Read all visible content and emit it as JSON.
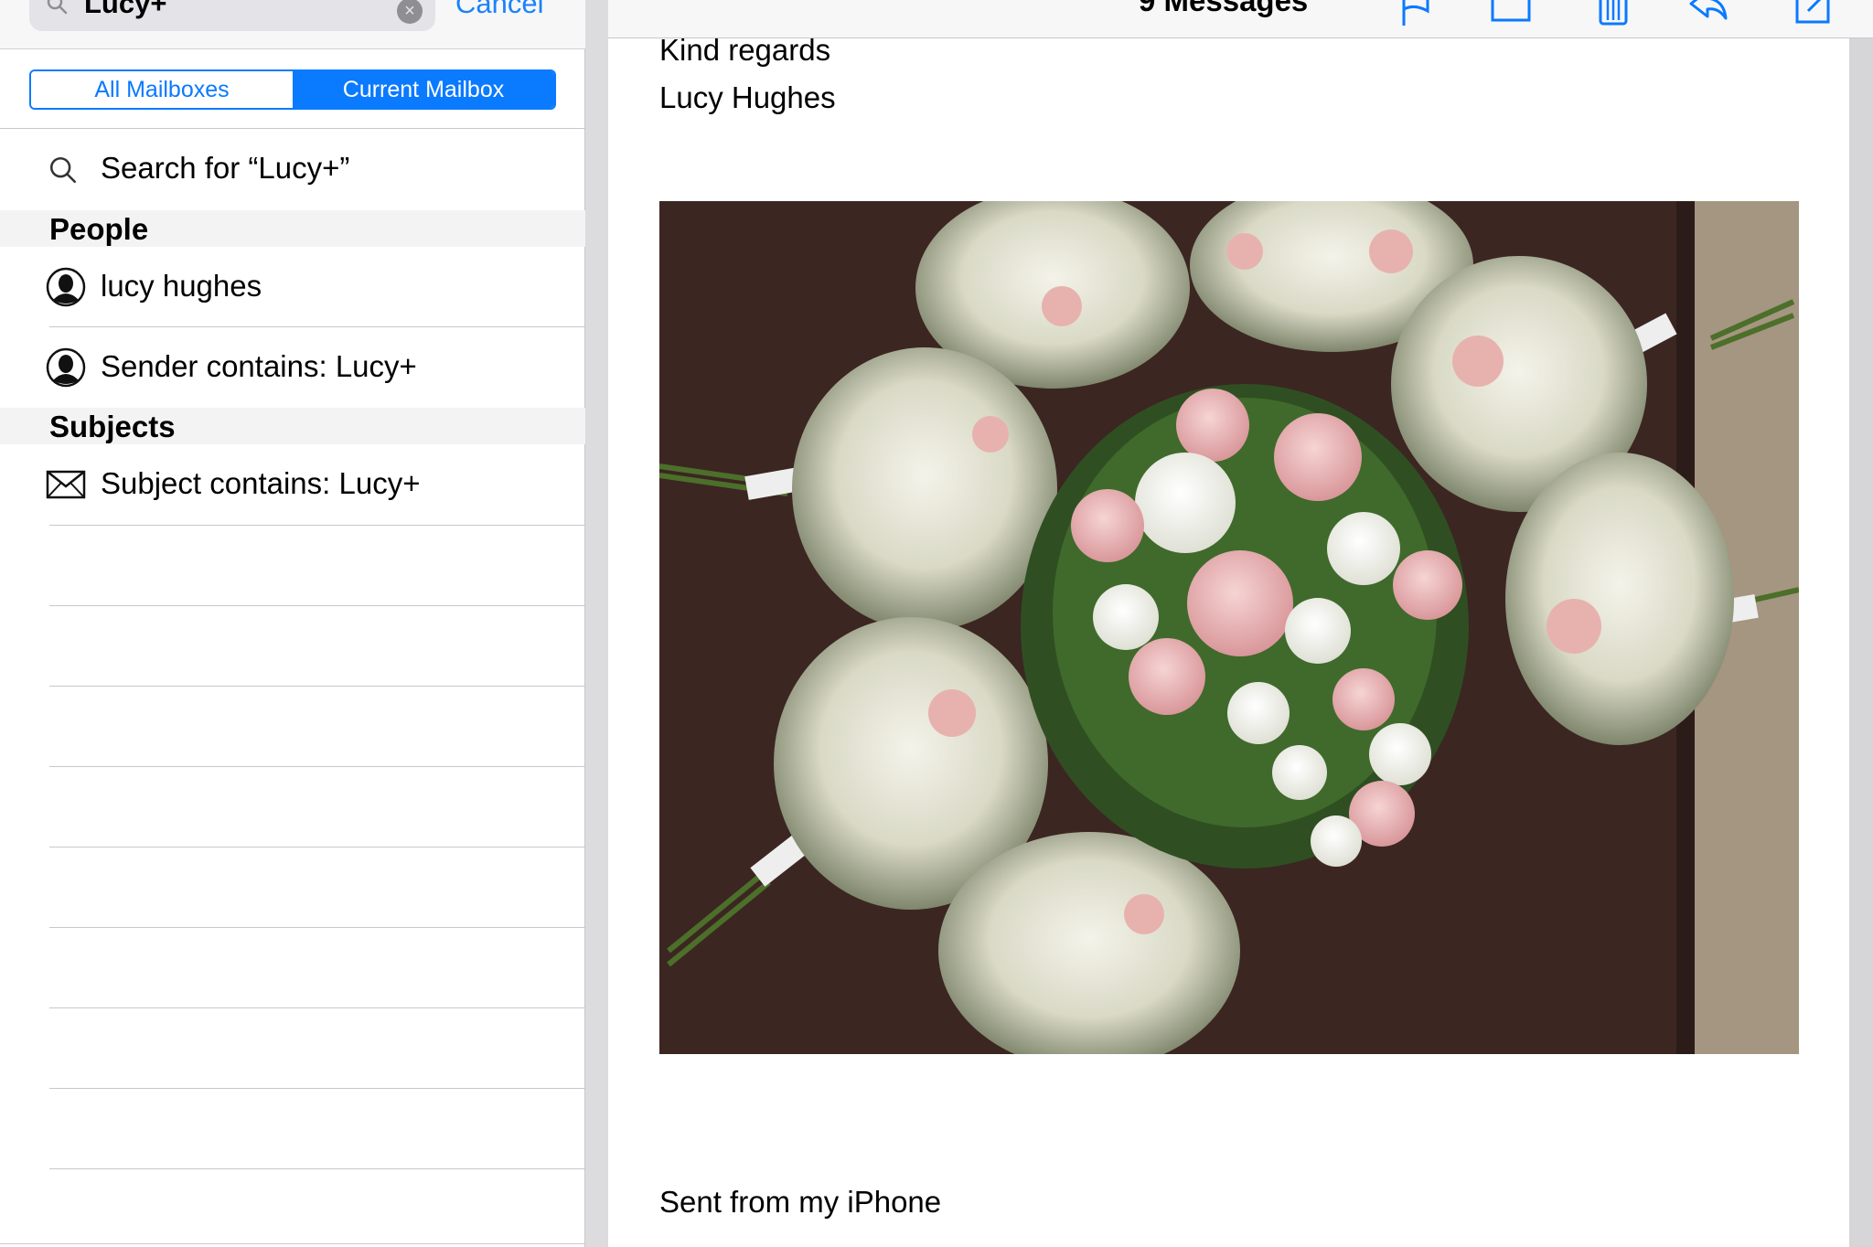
{
  "search": {
    "query": "Lucy+",
    "cancel_label": "Cancel"
  },
  "scope": {
    "all_label": "All Mailboxes",
    "current_label": "Current Mailbox",
    "selected": "Current Mailbox"
  },
  "suggestions": {
    "search_for": "Search for “Lucy+”",
    "people_header": "People",
    "people": [
      {
        "label": "lucy hughes"
      },
      {
        "label": "Sender contains: Lucy+"
      }
    ],
    "subjects_header": "Subjects",
    "subjects": [
      {
        "label": "Subject contains: Lucy+"
      }
    ]
  },
  "message": {
    "toolbar_title": "9 Messages",
    "closing": "Kind regards",
    "signature": "Lucy Hughes",
    "footer": "Sent from my iPhone"
  },
  "colors": {
    "accent": "#0a7aff",
    "link": "#1a82fb",
    "separator": "#c8c7cc"
  },
  "icons": {
    "search": "magnifier-icon",
    "clear": "clear-circle-icon",
    "person": "person-silhouette-icon",
    "envelope": "envelope-icon",
    "flag": "flag-icon",
    "folder": "folder-icon",
    "trash": "trash-icon",
    "reply": "reply-icon",
    "compose": "compose-icon"
  }
}
